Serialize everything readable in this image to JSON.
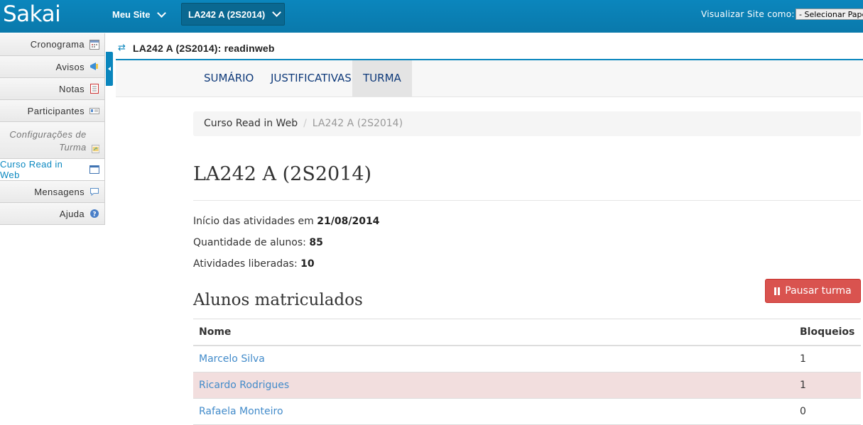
{
  "topbar": {
    "logo": "Sakai",
    "my_sites": "Meu Site",
    "current_site": "LA242 A (2S2014)",
    "view_as_label": "Visualizar Site como:",
    "role_select_value": "- Selecionar Papel"
  },
  "leftnav": {
    "items": [
      {
        "label": "Cronograma",
        "icon": "calendar-icon"
      },
      {
        "label": "Avisos",
        "icon": "announcements-icon"
      },
      {
        "label": "Notas",
        "icon": "gradebook-icon"
      },
      {
        "label": "Participantes",
        "icon": "roster-icon"
      },
      {
        "label": "Configurações de Turma",
        "icon": "site-settings-icon"
      },
      {
        "label": "Curso Read in Web",
        "icon": "window-icon"
      },
      {
        "label": "Mensagens",
        "icon": "messages-icon"
      },
      {
        "label": "Ajuda",
        "icon": "help-icon"
      }
    ]
  },
  "tool": {
    "title": "LA242 A (2S2014): readinweb"
  },
  "tabs": [
    {
      "label": "SUMÁRIO"
    },
    {
      "label": "JUSTIFICATIVAS"
    },
    {
      "label": "TURMA",
      "active": true
    }
  ],
  "breadcrumb": {
    "root": "Curso Read in Web",
    "current": "LA242 A (2S2014)"
  },
  "page": {
    "title": "LA242 A (2S2014)",
    "start_label": "Início das atividades em",
    "start_value": "21/08/2014",
    "students_label": "Quantidade de alunos:",
    "students_value": "85",
    "activities_label": "Atividades liberadas:",
    "activities_value": "10",
    "pause_button": "Pausar turma",
    "section_title": "Alunos matriculados"
  },
  "students_table": {
    "columns": [
      "Nome",
      "Bloqueios"
    ],
    "rows": [
      {
        "name": "Marcelo Silva",
        "blocks": "1"
      },
      {
        "name": "Ricardo Rodrigues",
        "blocks": "1"
      },
      {
        "name": "Rafaela Monteiro",
        "blocks": "0"
      }
    ]
  },
  "colors": {
    "brand": "#0a86bd",
    "danger": "#d9534f",
    "link": "#428bca"
  }
}
